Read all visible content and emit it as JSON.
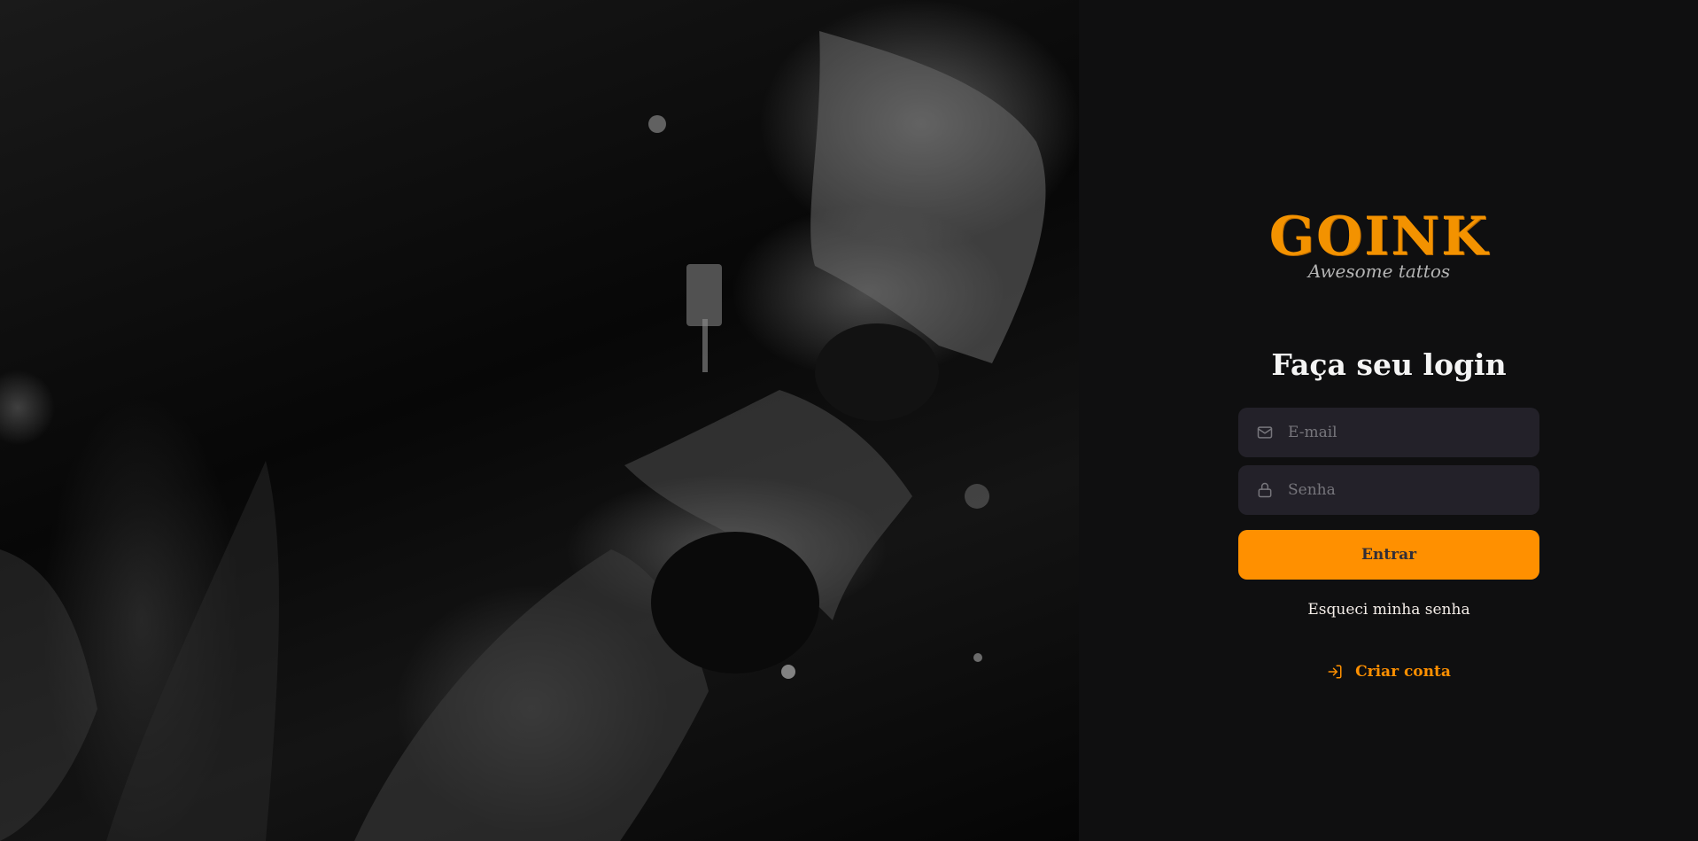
{
  "hero": {
    "image_alt": "Tattoo artist with black gloves tattooing"
  },
  "logo": {
    "word": "GOINK",
    "tagline": "Awesome tattos"
  },
  "login": {
    "title": "Faça seu login",
    "email_placeholder": "E-mail",
    "email_icon": "mail-icon",
    "password_placeholder": "Senha",
    "password_icon": "lock-icon",
    "submit_label": "Entrar",
    "forgot_label": "Esqueci minha senha",
    "create_label": "Criar conta",
    "create_icon": "log-in-icon"
  },
  "colors": {
    "accent": "#ff9000",
    "panel_bg": "#0f0f10",
    "input_bg": "#232129",
    "text": "#f4ede8",
    "placeholder": "#77767c"
  }
}
